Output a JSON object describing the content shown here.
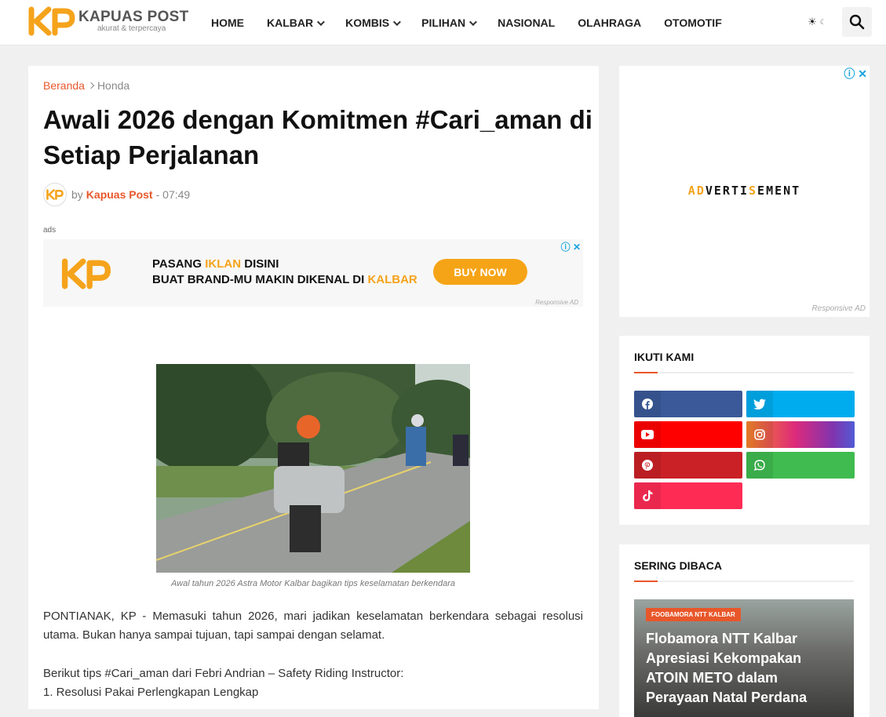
{
  "header": {
    "logo_name": "KAPUAS POST",
    "logo_tagline": "akurat & terpercaya",
    "nav": [
      {
        "label": "HOME",
        "dropdown": false
      },
      {
        "label": "KALBAR",
        "dropdown": true
      },
      {
        "label": "KOMBIS",
        "dropdown": true
      },
      {
        "label": "PILIHAN",
        "dropdown": true
      },
      {
        "label": "NASIONAL",
        "dropdown": false
      },
      {
        "label": "OLAHRAGA",
        "dropdown": false
      },
      {
        "label": "OTOMOTIF",
        "dropdown": false
      }
    ],
    "theme_icon": "sun-icon",
    "search_icon": "search-icon"
  },
  "article": {
    "breadcrumb_home": "Beranda",
    "breadcrumb_current": "Honda",
    "title": "Awali 2026 dengan Komitmen #Cari_aman di Setiap Perjalanan",
    "by": "by",
    "author": "Kapuas Post",
    "time": "- 07:49",
    "ads_label": "ads",
    "ad_banner": {
      "line1_a": "PASANG ",
      "line1_hl": "IKLAN",
      "line1_b": " DISINI",
      "line2_a": "BUAT BRAND-MU MAKIN DIKENAL DI ",
      "line2_hl": "KALBAR",
      "button": "BUY NOW",
      "responsive": "Responsive AD"
    },
    "caption": "Awal tahun 2026 Astra Motor Kalbar bagikan tips keselamatan berkendara",
    "paragraph1": "PONTIANAK, KP - Memasuki tahun 2026, mari jadikan keselamatan berkendara sebagai resolusi utama. Bukan hanya sampai tujuan, tapi sampai dengan selamat.",
    "paragraph2": "Berikut tips #Cari_aman dari Febri Andrian – Safety Riding Instructor:",
    "paragraph3": "1. Resolusi Pakai Perlengkapan Lengkap"
  },
  "sidebar": {
    "ad": {
      "text": "ADVERTISEMENT",
      "responsive": "Responsive AD"
    },
    "follow": {
      "title": "IKUTI KAMI",
      "buttons": [
        {
          "name": "facebook",
          "icon": "facebook-icon",
          "color": "#3b5998"
        },
        {
          "name": "twitter",
          "icon": "twitter-icon",
          "color": "#00acee"
        },
        {
          "name": "youtube",
          "icon": "youtube-icon",
          "color": "#ff0000"
        },
        {
          "name": "instagram",
          "icon": "instagram-icon",
          "color": "#c13584"
        },
        {
          "name": "pinterest",
          "icon": "pinterest-icon",
          "color": "#ca2127"
        },
        {
          "name": "whatsapp",
          "icon": "whatsapp-icon",
          "color": "#3fbb50"
        },
        {
          "name": "tiktok",
          "icon": "tiktok-icon",
          "color": "#fe2c55"
        }
      ]
    },
    "popular": {
      "title": "SERING DIBACA",
      "tag": "FOOBAMORA NTT KALBAR",
      "headline": "Flobamora NTT Kalbar Apresiasi Kekompakan ATOIN METO dalam Perayaan Natal Perdana"
    }
  },
  "colors": {
    "accent": "#e8572a",
    "ad_orange": "#f6a417",
    "info_blue": "#19a3e0"
  }
}
